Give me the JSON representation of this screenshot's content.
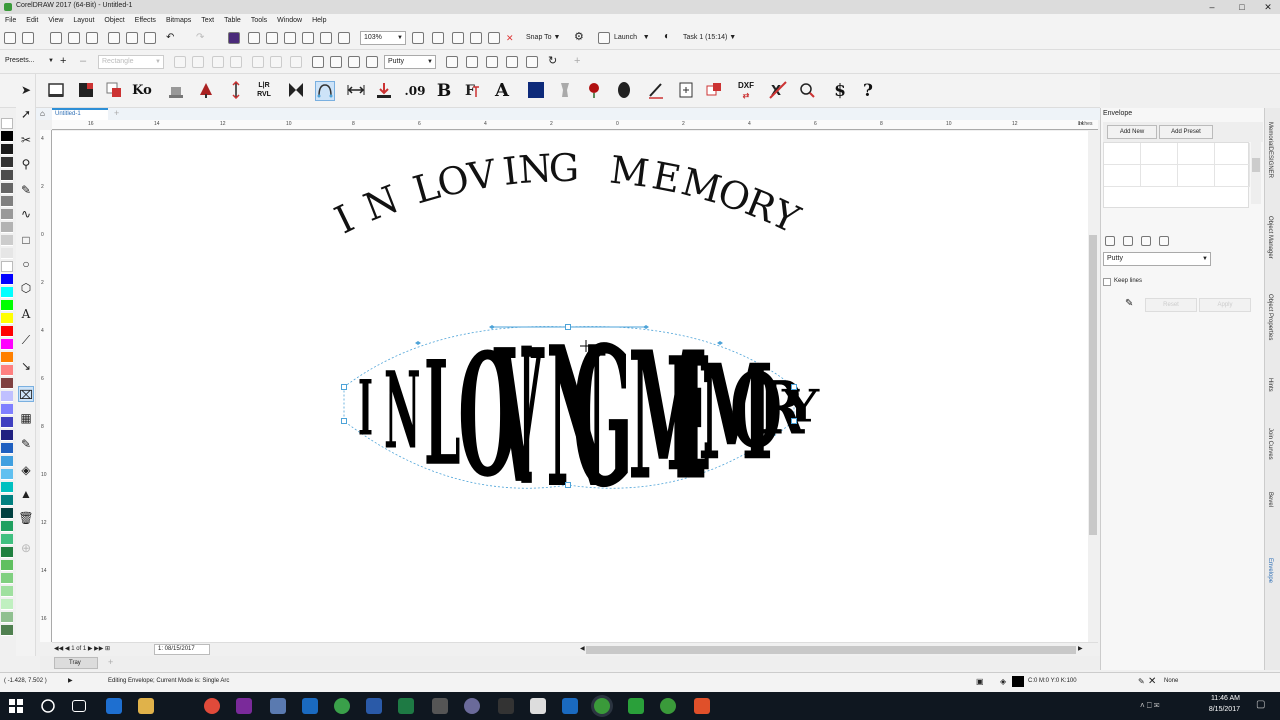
{
  "window": {
    "title": "CorelDRAW 2017 (64-Bit) - Untitled-1"
  },
  "menu": {
    "items": [
      "File",
      "Edit",
      "View",
      "Layout",
      "Object",
      "Effects",
      "Bitmaps",
      "Text",
      "Table",
      "Tools",
      "Window",
      "Help"
    ]
  },
  "standard_toolbar": {
    "zoom_level": "103%",
    "snap_to": "Snap To",
    "launch": "Launch",
    "task": "Task 1 (15:14)"
  },
  "property_bar": {
    "presets": "Presets...",
    "rectangle_combo": "Rectangle",
    "mapping_mode": "Putty"
  },
  "macro_toolbar": {
    "glyphs": {
      "ko": "Ko",
      "lir": "L|R",
      "rvl": "RVL",
      "num09": ".09",
      "bold_b": "B",
      "font_a": "A",
      "dxf": "DXF",
      "dollar": "$",
      "help": "?"
    }
  },
  "document": {
    "tab": "Untitled-1",
    "page_info": "1 of 1",
    "page_name": "1: 08/15/2017",
    "tray": "Tray"
  },
  "artwork": {
    "arc_text": [
      "I",
      "N",
      "L",
      "O",
      "V",
      "I",
      "N",
      "G",
      "M",
      "E",
      "M",
      "O",
      "R",
      "Y"
    ],
    "envelope_text": [
      "I",
      "N",
      "L",
      "O",
      "V",
      "I",
      "N",
      "G",
      "M",
      "E",
      "M",
      "O",
      "R",
      "Y"
    ]
  },
  "rulers": {
    "h_labels": [
      "16",
      "14",
      "12",
      "10",
      "8",
      "6",
      "4",
      "2",
      "0",
      "2",
      "4",
      "6",
      "8",
      "10",
      "12",
      "14",
      "inches"
    ],
    "v_labels": [
      "4",
      "2",
      "0",
      "2",
      "4",
      "6",
      "8",
      "10",
      "12",
      "14",
      "16"
    ]
  },
  "docker": {
    "title": "Envelope",
    "add_new": "Add New",
    "add_preset": "Add Preset",
    "mapping_mode": "Putty",
    "keep_lines": "Keep lines",
    "keep_lines_checked": false,
    "reset": "Reset",
    "apply": "Apply",
    "side_tabs": [
      "MemorialDESIGNER",
      "Object Manager",
      "Object Properties",
      "Hints",
      "Join Curves",
      "Bevel",
      "Envelope"
    ]
  },
  "status": {
    "coords": "( -1.428, 7.502 )",
    "message": "Editing Envelope; Current Mode is: Single Arc",
    "fill_color": "C:0 M:0 Y:0 K:100",
    "outline": "None"
  },
  "taskbar": {
    "time": "11:46 AM",
    "date": "8/15/2017"
  },
  "colors": {
    "accent": "#2e8fd6",
    "envelope_guide": "#4da3d8",
    "taskbar": "#0f1720"
  },
  "palette": [
    "#ffffff",
    "#000000",
    "#1a1a1a",
    "#333333",
    "#4d4d4d",
    "#666666",
    "#808080",
    "#999999",
    "#b3b3b3",
    "#cccccc",
    "#e6e6e6",
    "#ffffff",
    "#0000ff",
    "#00ffff",
    "#00ff00",
    "#ffff00",
    "#ff0000",
    "#ff00ff",
    "#ff8000",
    "#ff8080",
    "#804040",
    "#c0c0ff",
    "#8080ff",
    "#4040c0",
    "#202080",
    "#2060c0",
    "#40a0e0",
    "#60c0f0",
    "#00c0c0",
    "#008080",
    "#004040",
    "#20a060",
    "#40c080",
    "#208040",
    "#60c060",
    "#80d080",
    "#a0e0a0",
    "#c0f0c0",
    "#90c090",
    "#508050"
  ]
}
